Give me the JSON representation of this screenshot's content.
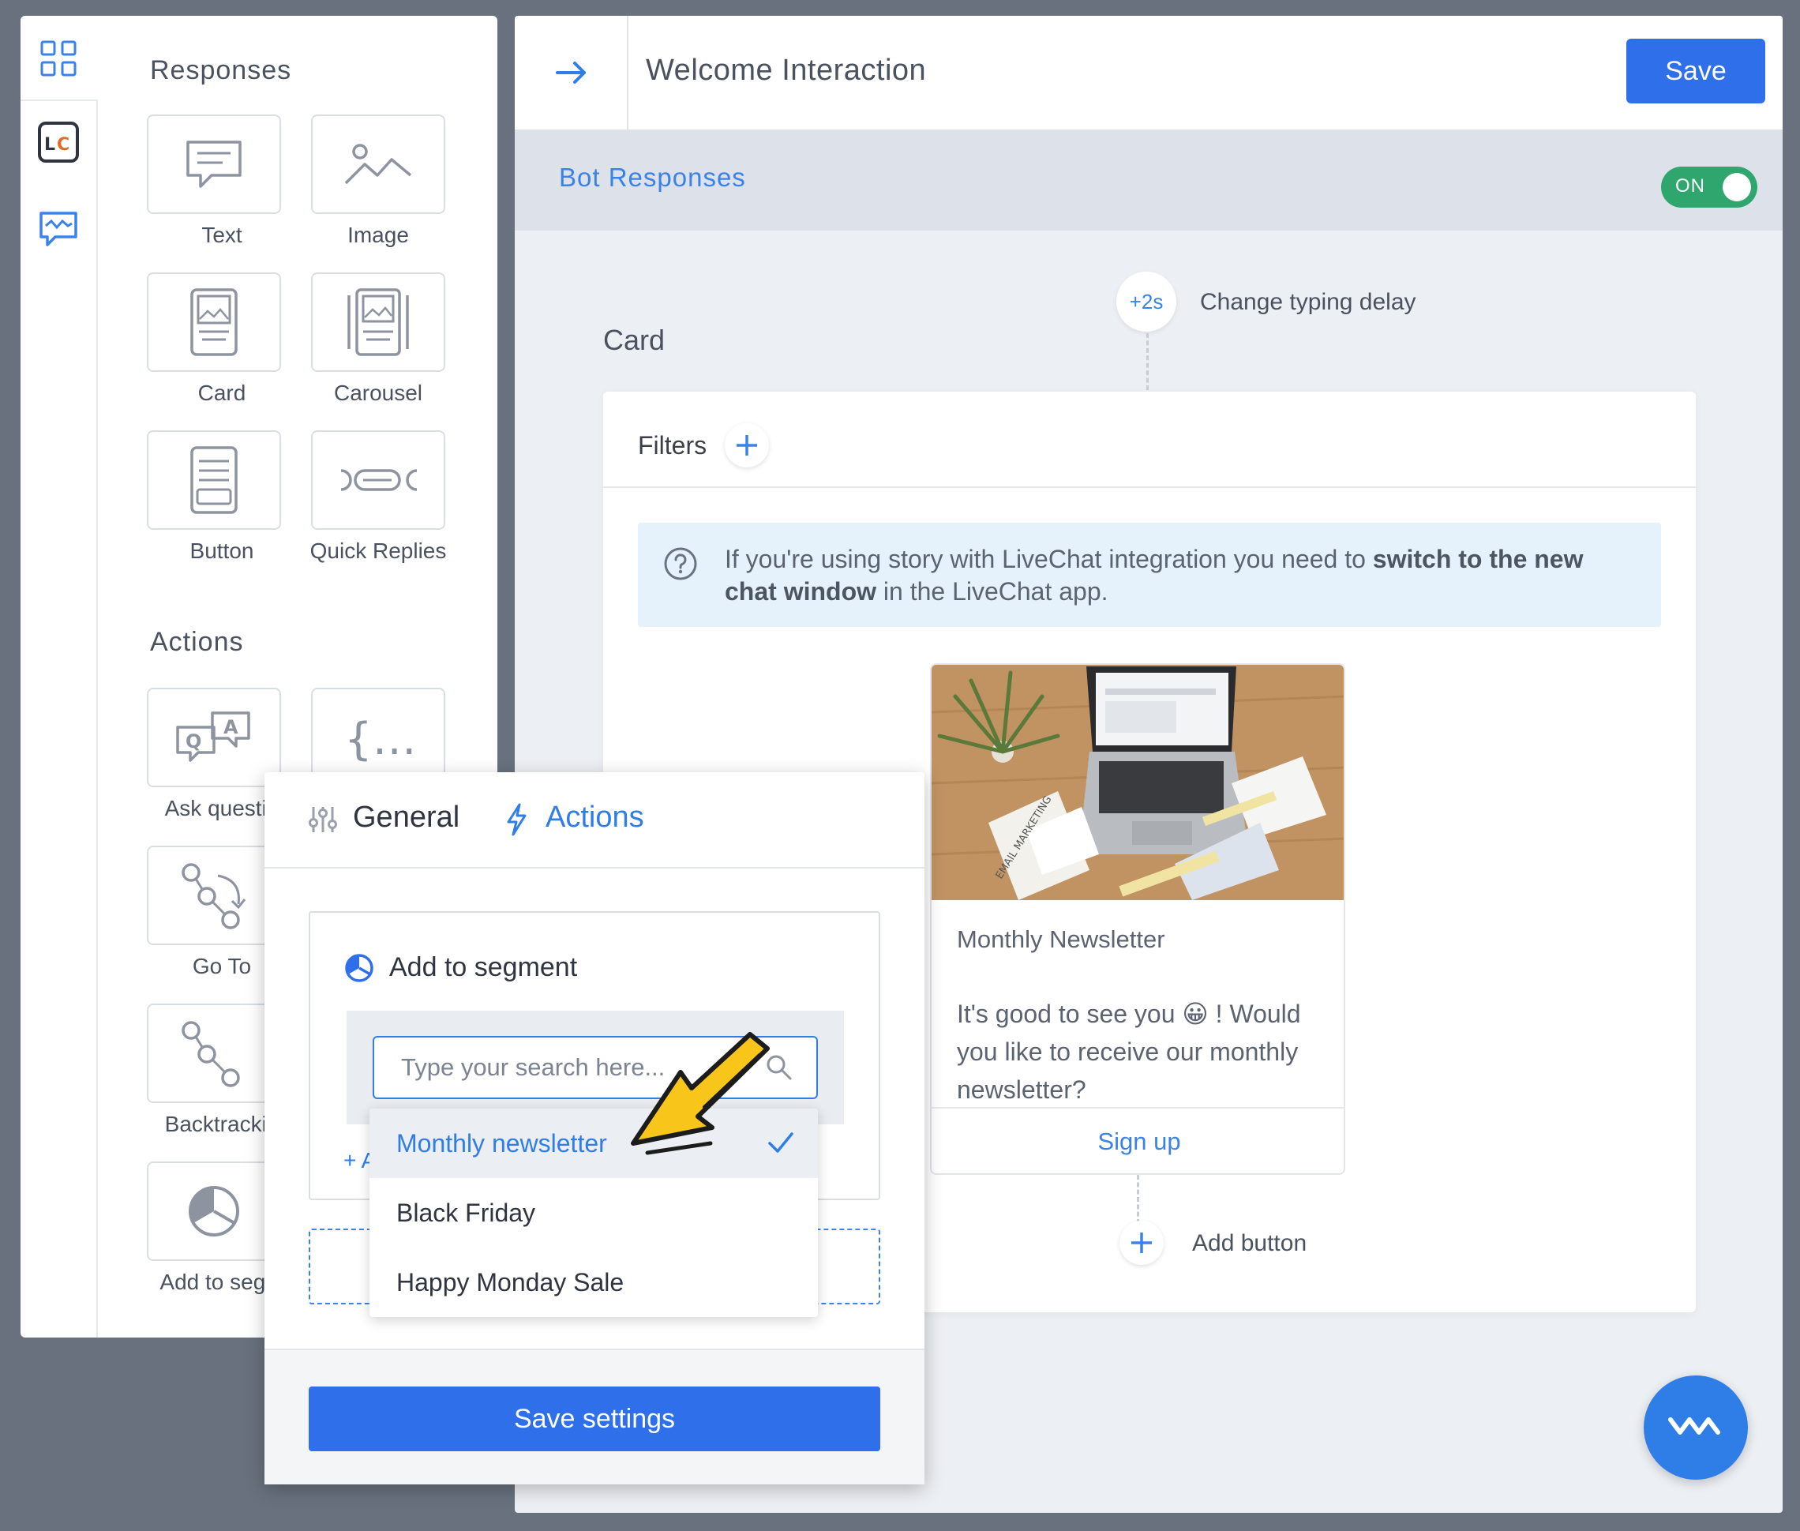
{
  "sidebar": {
    "responses_title": "Responses",
    "actions_title": "Actions",
    "responses": [
      {
        "label": "Text",
        "icon": "text-bubble-icon"
      },
      {
        "label": "Image",
        "icon": "image-icon"
      },
      {
        "label": "Card",
        "icon": "card-icon"
      },
      {
        "label": "Carousel",
        "icon": "carousel-icon"
      },
      {
        "label": "Button",
        "icon": "button-icon"
      },
      {
        "label": "Quick Replies",
        "icon": "quick-replies-icon"
      }
    ],
    "actions": [
      {
        "label": "Ask questio",
        "icon": "qa-icon"
      },
      {
        "label": "",
        "icon": "curly-braces-icon"
      },
      {
        "label": "Go To",
        "icon": "goto-icon"
      },
      {
        "label": "Backtrackin",
        "icon": "backtracking-icon"
      },
      {
        "label": "Add to segm",
        "icon": "segment-pie-icon"
      }
    ],
    "rail_icons": [
      "grid-icon",
      "livechat-logo-icon",
      "chatbot-icon"
    ]
  },
  "header": {
    "title": "Welcome Interaction",
    "save_label": "Save"
  },
  "bot_bar": {
    "label": "Bot Responses",
    "toggle_label": "ON"
  },
  "flow": {
    "delay_badge": "+2s",
    "delay_text": "Change typing delay",
    "card_heading": "Card",
    "filters_label": "Filters",
    "info_prefix": "If you're using story with LiveChat integration you need to ",
    "info_bold": "switch to the new chat window",
    "info_suffix": " in the LiveChat app.",
    "preview": {
      "title": "Monthly Newsletter",
      "body_before": "It's good to see you ",
      "body_emoji": "😀",
      "body_after": " ! Would you like to receive our monthly newsletter?",
      "button_label": "Sign up",
      "image_caption": "EMAIL MARKETING"
    },
    "add_button_label": "Add button"
  },
  "modal": {
    "tab_general": "General",
    "tab_actions": "Actions",
    "action_title": "Add to segment",
    "search_placeholder": "Type your search here...",
    "add_link": "+ A",
    "save_settings": "Save settings"
  },
  "dropdown": {
    "options": [
      "Monthly newsletter",
      "Black Friday",
      "Happy Monday Sale"
    ],
    "selected_index": 0
  },
  "colors": {
    "accent": "#2f6fe9",
    "link": "#3a82e8",
    "toggle_on": "#2ea66e",
    "background": "#68717d"
  }
}
